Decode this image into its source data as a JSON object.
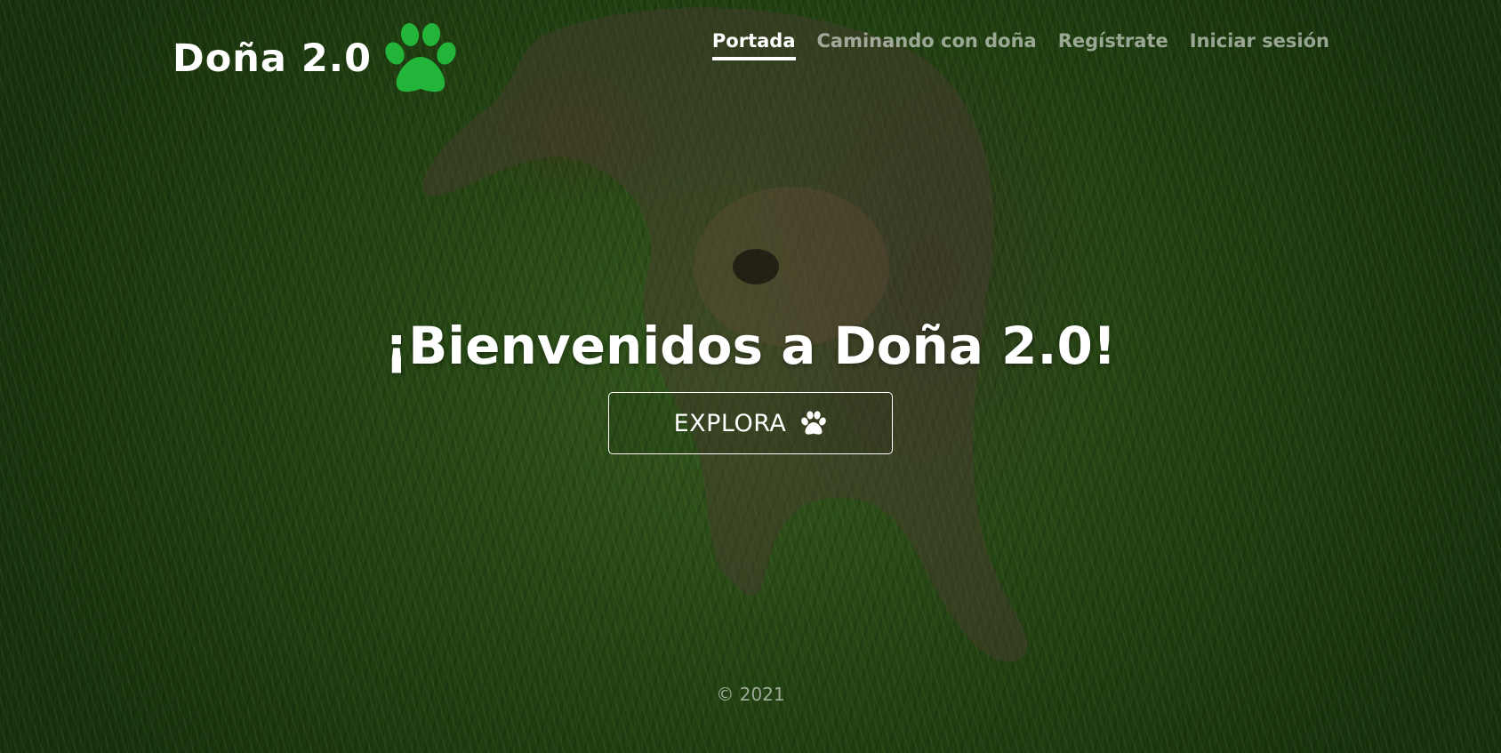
{
  "brand": {
    "name": "Doña 2.0",
    "logo_icon": "paw-icon",
    "logo_color": "#22b53a"
  },
  "nav": {
    "items": [
      {
        "label": "Portada",
        "active": true
      },
      {
        "label": "Caminando con doña",
        "active": false
      },
      {
        "label": "Regístrate",
        "active": false
      },
      {
        "label": "Iniciar sesión",
        "active": false
      }
    ]
  },
  "hero": {
    "heading": "¡Bienvenidos a Doña 2.0!",
    "button_label": "EXPLORA",
    "button_icon": "paw-icon",
    "background": "dog-on-grass-photo"
  },
  "footer": {
    "copyright": "© 2021"
  }
}
